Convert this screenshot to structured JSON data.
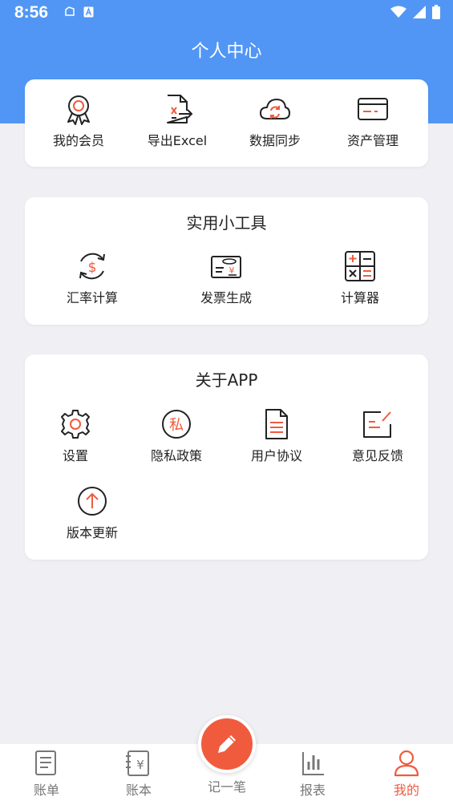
{
  "status_bar": {
    "time": "8:56"
  },
  "header": {
    "title": "个人中心"
  },
  "top_section": {
    "items": [
      {
        "label": "我的会员",
        "icon": "medal-icon"
      },
      {
        "label": "导出Excel",
        "icon": "export-excel-icon"
      },
      {
        "label": "数据同步",
        "icon": "cloud-sync-icon"
      },
      {
        "label": "资产管理",
        "icon": "card-icon"
      }
    ]
  },
  "tools_section": {
    "title": "实用小工具",
    "items": [
      {
        "label": "汇率计算",
        "icon": "exchange-rate-icon"
      },
      {
        "label": "发票生成",
        "icon": "invoice-icon"
      },
      {
        "label": "计算器",
        "icon": "calculator-icon"
      }
    ]
  },
  "about_section": {
    "title": "关于APP",
    "items": [
      {
        "label": "设置",
        "icon": "gear-icon"
      },
      {
        "label": "隐私政策",
        "icon": "privacy-icon"
      },
      {
        "label": "用户协议",
        "icon": "document-icon"
      },
      {
        "label": "意见反馈",
        "icon": "feedback-icon"
      },
      {
        "label": "版本更新",
        "icon": "upgrade-icon"
      }
    ]
  },
  "tabbar": {
    "tabs": [
      {
        "label": "账单",
        "icon": "bill-icon"
      },
      {
        "label": "账本",
        "icon": "ledger-icon"
      },
      {
        "label": "记一笔",
        "icon": "pencil-icon"
      },
      {
        "label": "报表",
        "icon": "chart-icon"
      },
      {
        "label": "我的",
        "icon": "user-icon",
        "active": true
      }
    ]
  },
  "colors": {
    "primary": "#5196f5",
    "accent": "#f05b3e",
    "background": "#f0eff4"
  }
}
